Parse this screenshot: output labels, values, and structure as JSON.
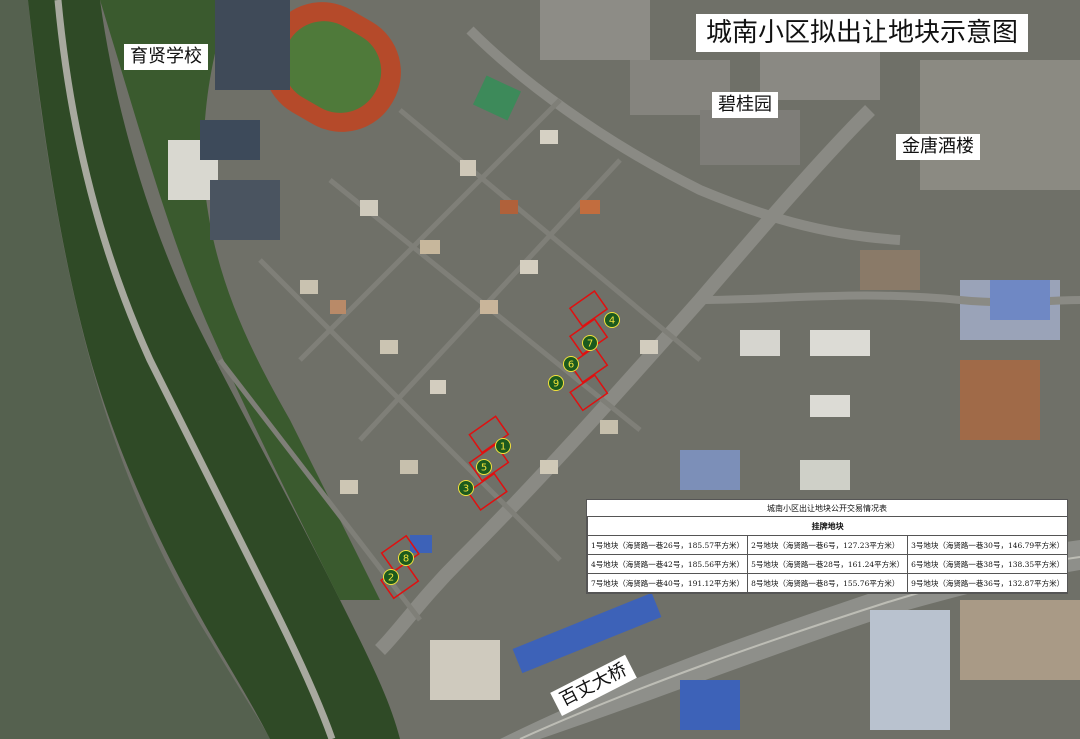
{
  "title": "城南小区拟出让地块示意图",
  "places": {
    "school": "育贤学校",
    "biguiyuan": "碧桂园",
    "jintang": "金唐酒楼",
    "bridge": "百丈大桥"
  },
  "parcels": {
    "labels": [
      "1",
      "2",
      "3",
      "4",
      "5",
      "6",
      "7",
      "8",
      "9"
    ],
    "outline_color": "#e01010",
    "fill_color": "#1b5a1e",
    "number_color": "#f2e23a"
  },
  "table": {
    "title": "城南小区出让地块公开交易情况表",
    "header": "挂牌地块",
    "rows": [
      [
        "1号地块（海贤路一巷26号，185.57平方米）",
        "2号地块（海贤路一巷6号，127.23平方米）",
        "3号地块（海贤路一巷30号，146.79平方米）"
      ],
      [
        "4号地块（海贤路一巷42号，185.56平方米）",
        "5号地块（海贤路一巷28号，161.24平方米）",
        "6号地块（海贤路一巷38号，138.35平方米）"
      ],
      [
        "7号地块（海贤路一巷40号，191.12平方米）",
        "8号地块（海贤路一巷8号，155.76平方米）",
        "9号地块（海贤路一巷36号，132.87平方米）"
      ]
    ]
  },
  "colors": {
    "river": "#55614f",
    "greenery": "#2f4a26",
    "track": "#b54a2a",
    "pitch": "#4f7a3a",
    "pool": "#3a9aa8",
    "roof_blue": "#3d62b8",
    "road": "#8a8a84"
  }
}
